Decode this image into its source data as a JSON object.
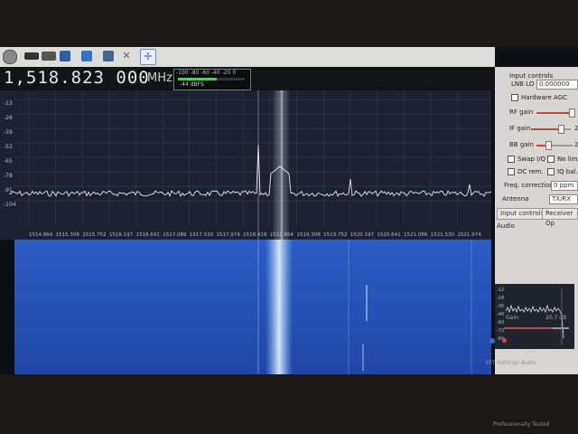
{
  "toolbar": {
    "buttons": [
      "power-icon",
      "device-icon",
      "folder-icon",
      "save-icon",
      "screenshot-icon",
      "network-icon",
      "tools-icon",
      "crosshair-icon"
    ]
  },
  "frequency": {
    "value": "1,518.823 000",
    "unit": "MHz"
  },
  "smeter": {
    "ticks": "-100  -80  -60  -40  -20   0",
    "reading": "-44 dBFS",
    "level": 0.58
  },
  "fft": {
    "y_ticks": [
      "-13",
      "-26",
      "-39",
      "-52",
      "-65",
      "-78",
      "-91",
      "-104"
    ],
    "x_ticks": [
      "1514.864",
      "1515.308",
      "1515.752",
      "1516.197",
      "1516.641",
      "1517.086",
      "1517.530",
      "1517.974",
      "1518.419",
      "1518.864",
      "1519.308",
      "1519.752",
      "1520.197",
      "1520.641",
      "1521.086",
      "1521.530",
      "1521.974"
    ]
  },
  "panel": {
    "title": "Input controls",
    "lnb_label": "LNB LO",
    "lnb_value": "0.000000",
    "hw_agc": "Hardware AGC",
    "rf_gain": "RF gain",
    "if_gain": "IF gain",
    "bb_gain": "BB gain",
    "if_val": "2",
    "bb_val": "2",
    "swap_iq": "Swap I/Q",
    "no_limit": "No limi",
    "dc_rem": "DC rem.",
    "iq_bal": "IQ bal.",
    "freq_corr": "Freq. correction",
    "freq_corr_val": "0 ppm",
    "antenna": "Antenna",
    "antenna_val": "TX/RX",
    "tab1": "Input controls",
    "tab2": "Receiver Op",
    "audio_label": "Audio"
  },
  "audio": {
    "y_ticks": [
      "-12",
      "-24",
      "-36",
      "-48",
      "-60",
      "-72",
      "-84"
    ],
    "gain_label": "Gain:",
    "gain_value": "20.7 dB",
    "dsp": "DSP",
    "tabs_text": "FFT Settings   Audio"
  },
  "brand": "Professionally Tested"
}
